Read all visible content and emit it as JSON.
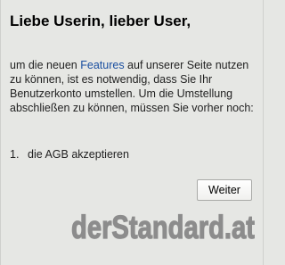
{
  "dialog": {
    "heading": "Liebe Userin, lieber User,",
    "message_before_link": "um die neuen ",
    "features_link": "Features",
    "message_after_link": " auf unserer Seite nutzen zu können, ist es notwendig, dass Sie Ihr Benutzerkonto umstellen. Um die Umstellung abschließen zu können, müssen Sie vorher noch:",
    "steps": [
      {
        "number": "1.",
        "text": "die AGB akzeptieren"
      }
    ],
    "next_button_label": "Weiter"
  },
  "brand": {
    "logo_text": "derStandard.at",
    "logo_color": "#8c8c8c"
  },
  "colors": {
    "background": "#e6e7e4",
    "link": "#1a4fa0"
  }
}
